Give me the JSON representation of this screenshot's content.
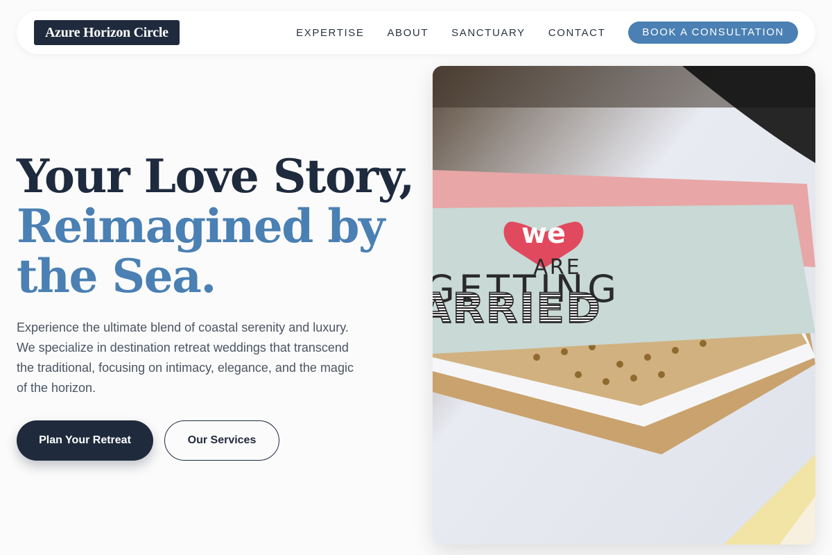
{
  "brand": {
    "name": "Azure Horizon Circle"
  },
  "nav": {
    "links": [
      "EXPERTISE",
      "ABOUT",
      "SANCTUARY",
      "CONTACT"
    ],
    "cta": "BOOK A CONSULTATION"
  },
  "hero": {
    "headline_line1": "Your Love Story,",
    "headline_accent_1": "Reimagined by",
    "headline_accent_2": "the Sea.",
    "description": "Experience the ultimate blend of coastal serenity and luxury. We specialize in destination retreat weddings that transcend the traditional, focusing on intimacy, elegance, and the magic of the horizon.",
    "primary_button": "Plan Your Retreat",
    "secondary_button": "Our Services"
  },
  "photo": {
    "card_text_1": "we",
    "card_text_2": "ARE",
    "card_text_3": "GETTING",
    "card_text_4": "ARRIED"
  },
  "colors": {
    "navy": "#1f2a3d",
    "accent_blue": "#4a80b3",
    "body_text": "#4b5563",
    "background": "#fbfbfb"
  }
}
